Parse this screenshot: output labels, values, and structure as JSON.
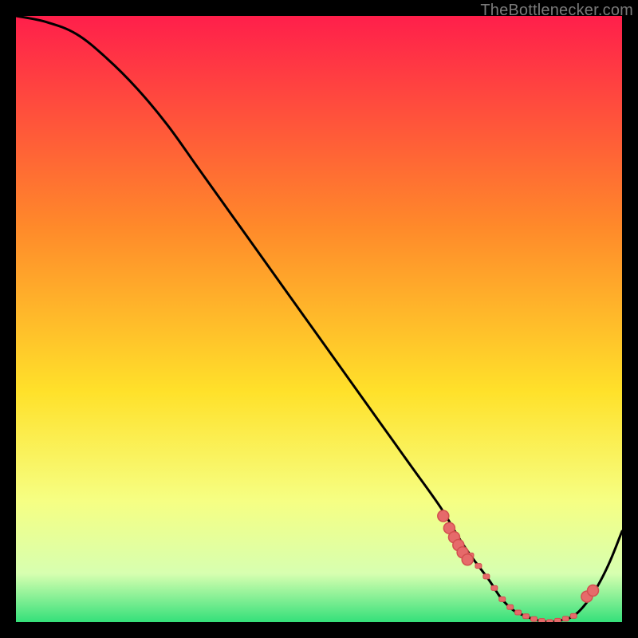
{
  "attribution": "TheBottlenecker.com",
  "chart_data": {
    "type": "line",
    "title": "",
    "xlabel": "",
    "ylabel": "",
    "xlim": [
      0,
      100
    ],
    "ylim": [
      0,
      100
    ],
    "x": [
      0,
      5,
      10,
      15,
      20,
      25,
      30,
      35,
      40,
      45,
      50,
      55,
      60,
      65,
      70,
      73,
      75,
      78,
      80,
      82,
      84,
      86,
      88,
      90,
      92,
      94,
      96,
      98,
      100
    ],
    "values": [
      100,
      99,
      97,
      93,
      88,
      82,
      75,
      68,
      61,
      54,
      47,
      40,
      33,
      26,
      19,
      14,
      11,
      7,
      4,
      2,
      1,
      0.3,
      0,
      0.3,
      1,
      3,
      6,
      10,
      15
    ],
    "markers": {
      "left_cluster_x": [
        70.5,
        71.5,
        72.3,
        73.0,
        73.7,
        74.5
      ],
      "left_cluster_y": [
        17.5,
        15.5,
        14.0,
        12.7,
        11.5,
        10.3
      ],
      "right_cluster_x": [
        94.2,
        95.2
      ],
      "right_cluster_y": [
        4.2,
        5.2
      ],
      "dash_start_x": 75.0,
      "dash_end_x": 92.0,
      "dash_y_start": 9.0,
      "dash_y_end": 2.5
    },
    "colors": {
      "gradient_top": "#ff1f4b",
      "gradient_mid1": "#ff8a2a",
      "gradient_mid2": "#ffe12a",
      "gradient_low1": "#f6ff83",
      "gradient_low2": "#d7ffb0",
      "gradient_bottom": "#35e07a",
      "curve": "#000000",
      "marker_fill": "#e66a6a",
      "marker_stroke": "#d24f4f"
    }
  }
}
